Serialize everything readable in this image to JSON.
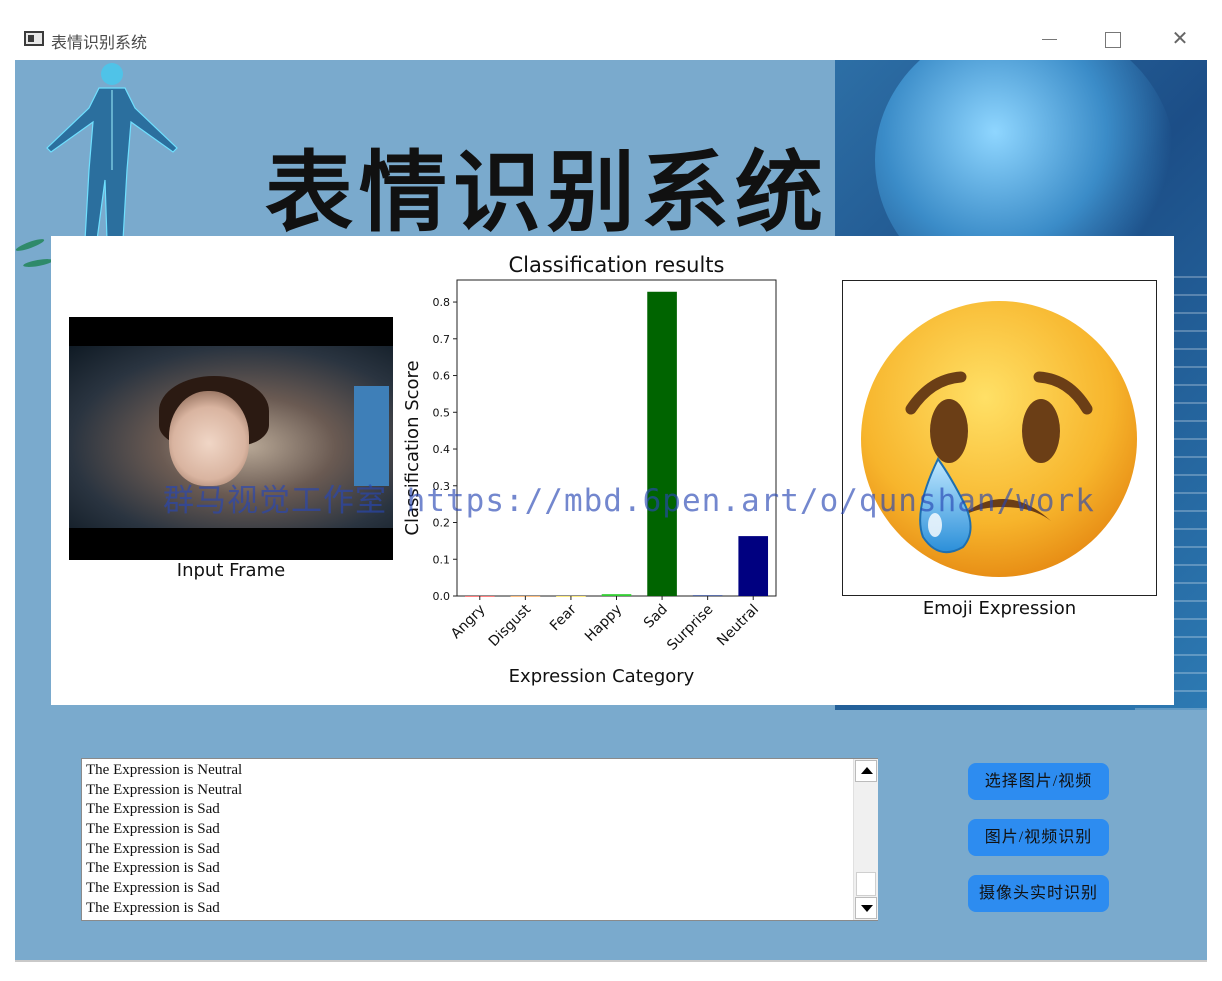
{
  "window": {
    "title": "表情识别系统",
    "minimize_glyph": "—",
    "maximize_glyph": "☐",
    "close_glyph": "✕"
  },
  "banner": {
    "title": "表情识别系统"
  },
  "figure": {
    "input_label": "Input Frame",
    "emoji_label": "Emoji Expression",
    "emoji_icon": "crying-face-icon",
    "watermark": "群马视觉工作室 https://mbd.6pen.art/o/qunshan/work"
  },
  "chart_data": {
    "type": "bar",
    "title": "Classification results",
    "xlabel": "Expression Category",
    "ylabel": "Classification Score",
    "categories": [
      "Angry",
      "Disgust",
      "Fear",
      "Happy",
      "Sad",
      "Surprise",
      "Neutral"
    ],
    "values": [
      0.0,
      0.0,
      0.0,
      0.005,
      0.828,
      0.002,
      0.163
    ],
    "bar_colors": [
      "#ff0000",
      "#ff7f00",
      "#ffd700",
      "#32cd32",
      "#006400",
      "#1e3a8a",
      "#000080"
    ],
    "ylim": [
      0,
      0.86
    ],
    "yticks": [
      "0.0",
      "0.1",
      "0.2",
      "0.3",
      "0.4",
      "0.5",
      "0.6",
      "0.7",
      "0.8"
    ],
    "grid": false
  },
  "log": {
    "lines": [
      "The Expression is Neutral",
      "The Expression is Neutral",
      "The Expression is Sad",
      "The Expression is Sad",
      "The Expression is Sad",
      "The Expression is Sad",
      "The Expression is Sad",
      "The Expression is Sad"
    ]
  },
  "buttons": {
    "select": "选择图片/视频",
    "recognize": "图片/视频识别",
    "camera": "摄像头实时识别"
  },
  "colors": {
    "background": "#7aaacd",
    "button": "#2d8cf0",
    "accent_dark": "#1c4e87"
  }
}
